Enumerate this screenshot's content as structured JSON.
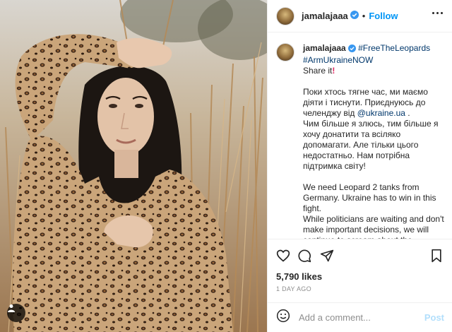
{
  "post": {
    "username": "jamalajaaa",
    "follow_label": "Follow",
    "separator": "•",
    "caption": {
      "username": "jamalajaaa",
      "hashtags": [
        "#FreeTheLeopards",
        "#ArmUkraineNOW"
      ],
      "line_share": "Share it",
      "exclamation": "!",
      "ua_text_1": "Поки хтось тягне час, ми маємо діяти і тиснути. Приєднуюсь до челенджу від ",
      "ua_mention": "@ukraine.ua",
      "ua_text_2": " .",
      "ua_text_3": "Чим більше я злюсь, тим більше я хочу донатити та всіляко допомагати. Але тільки цього недостатньо. Нам потрібна підтримка світу!",
      "en_text_1": "We need Leopard 2 tanks from Germany. Ukraine has to win in this fight.",
      "en_text_2": "While politicians are waiting and don't make important decisions, we will continue to scream about the importance of the delivery of tanks!"
    },
    "likes": "5,790 likes",
    "time": "1 DAY AGO",
    "comment_placeholder": "Add a comment...",
    "post_label": "Post"
  },
  "icons": [
    "verified-badge-icon",
    "more-options-icon",
    "heart-icon",
    "comment-icon",
    "share-icon",
    "bookmark-icon",
    "emoji-icon",
    "user-tag-icon"
  ],
  "colors": {
    "link_blue": "#0095f6",
    "hashtag": "#00376b",
    "post_disabled": "#b2dffc",
    "border": "#efefef"
  }
}
